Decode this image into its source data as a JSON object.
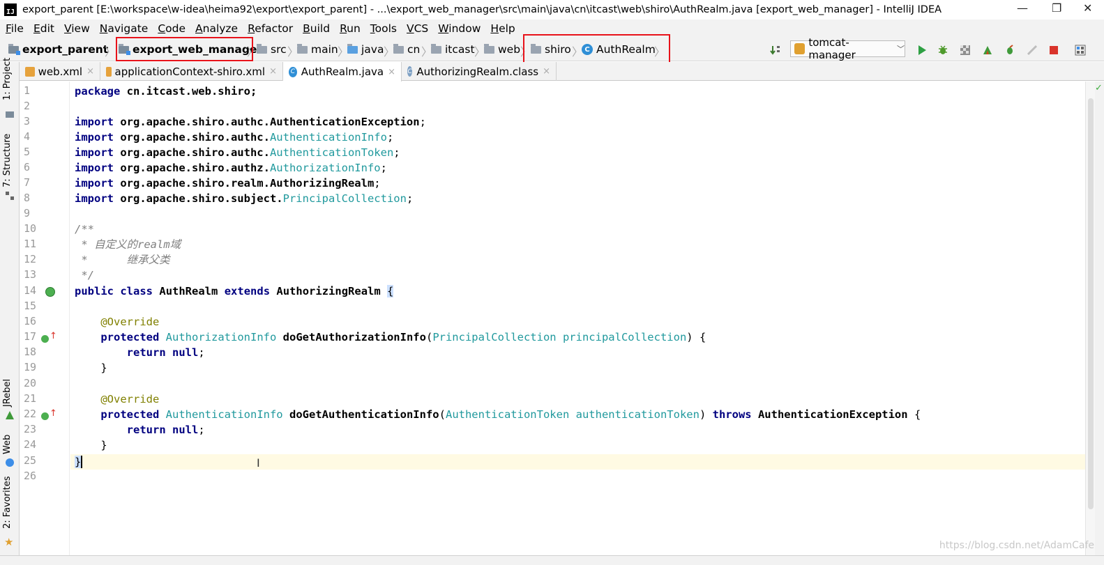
{
  "title": "export_parent [E:\\workspace\\w-idea\\heima92\\export\\export_parent] - ...\\export_web_manager\\src\\main\\java\\cn\\itcast\\web\\shiro\\AuthRealm.java [export_web_manager] - IntelliJ IDEA",
  "window_controls": {
    "minimize": "—",
    "restore": "❐",
    "close": "✕"
  },
  "menu": [
    "File",
    "Edit",
    "View",
    "Navigate",
    "Code",
    "Analyze",
    "Refactor",
    "Build",
    "Run",
    "Tools",
    "VCS",
    "Window",
    "Help"
  ],
  "breadcrumbs": [
    "export_parent",
    "export_web_manager",
    "src",
    "main",
    "java",
    "cn",
    "itcast",
    "web",
    "shiro",
    "AuthRealm"
  ],
  "run_config": "tomcat-manager",
  "tabs": [
    {
      "label": "web.xml"
    },
    {
      "label": "applicationContext-shiro.xml"
    },
    {
      "label": "AuthRealm.java"
    },
    {
      "label": "AuthorizingRealm.class"
    }
  ],
  "tab_close": "×",
  "side_tabs": [
    "1: Project",
    "7: Structure",
    "JRebel",
    "Web",
    "2: Favorites"
  ],
  "line_numbers": [
    "1",
    "2",
    "3",
    "4",
    "5",
    "6",
    "7",
    "8",
    "9",
    "10",
    "11",
    "12",
    "13",
    "14",
    "15",
    "16",
    "17",
    "18",
    "19",
    "20",
    "21",
    "22",
    "23",
    "24",
    "25",
    "26"
  ],
  "code": {
    "l1": {
      "kw": "package",
      "rest": " cn.itcast.web.shiro;"
    },
    "imports": [
      {
        "kw": "import",
        "pkg": " org.apache.shiro.authc.",
        "cls": "AuthenticationException",
        "end": ";",
        "bold": true
      },
      {
        "kw": "import",
        "pkg": " org.apache.shiro.authc.",
        "cls": "AuthenticationInfo",
        "end": ";",
        "bold": false
      },
      {
        "kw": "import",
        "pkg": " org.apache.shiro.authc.",
        "cls": "AuthenticationToken",
        "end": ";",
        "bold": false
      },
      {
        "kw": "import",
        "pkg": " org.apache.shiro.authz.",
        "cls": "AuthorizationInfo",
        "end": ";",
        "bold": false
      },
      {
        "kw": "import",
        "pkg": " org.apache.shiro.realm.",
        "cls": "AuthorizingRealm",
        "end": ";",
        "bold": true
      },
      {
        "kw": "import",
        "pkg": " org.apache.shiro.subject.",
        "cls": "PrincipalCollection",
        "end": ";",
        "bold": false
      }
    ],
    "c10": "/**",
    "c11": " * 自定义的realm域",
    "c12": " *      继承父类",
    "c13": " */",
    "l14": {
      "kw1": "public",
      "kw2": "class",
      "name": "AuthRealm",
      "kw3": "extends",
      "parent": "AuthorizingRealm",
      "brace": "{"
    },
    "ann": "@Override",
    "m1": {
      "kw": "protected",
      "ret": "AuthorizationInfo",
      "fn": "doGetAuthorizationInfo",
      "ptype": "PrincipalCollection",
      "pname": "principalCollection",
      "tail": ") {"
    },
    "ret_kw": "return",
    "ret_val": "null",
    "semi": ";",
    "close": "}",
    "m2": {
      "kw": "protected",
      "ret": "AuthenticationInfo",
      "fn": "doGetAuthenticationInfo",
      "ptype": "AuthenticationToken",
      "pname": "authenticationToken",
      "thr": "throws",
      "exc": "AuthenticationException",
      "tail": " {"
    },
    "l25": "}"
  },
  "watermark": "https://blog.csdn.net/AdamCafe",
  "colors": {
    "accent_red": "#e8121a",
    "keyword": "#000080",
    "annotation": "#808000",
    "comment": "#808080",
    "type": "#20999d"
  }
}
